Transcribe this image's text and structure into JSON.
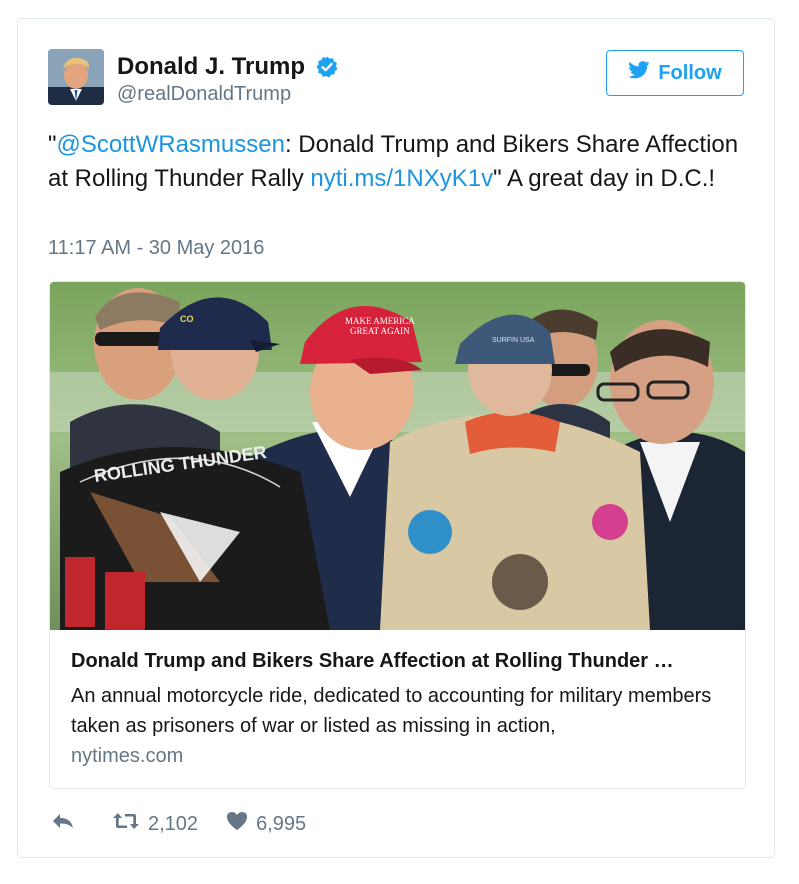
{
  "author": {
    "display_name": "Donald J. Trump",
    "handle": "@realDonaldTrump",
    "verified_icon": "verified-badge-icon"
  },
  "follow_button": {
    "label": "Follow",
    "icon": "twitter-bird-icon"
  },
  "tweet": {
    "quote_open": "\"",
    "mention": "@ScottWRasmussen",
    "text_part1": ": Donald Trump and Bikers Share Affection at Rolling Thunder Rally ",
    "link": "nyti.ms/1NXyK1v",
    "text_part2": "\" A great day in D.C.!",
    "timestamp": "11:17 AM - 30 May 2016"
  },
  "card": {
    "photo_text": {
      "vest_patch": "ROLLING THUNDER",
      "hat_text_line1": "MAKE AMERICA",
      "hat_text_line2": "GREAT AGAIN",
      "cap_text": "CO",
      "cap2_text": "SURFIN USA"
    },
    "title": "Donald Trump and Bikers Share Affection at Rolling Thunder …",
    "description": "An annual motorcycle ride, dedicated to accounting for military members taken as prisoners of war or listed as missing in action,",
    "domain": "nytimes.com"
  },
  "actions": {
    "reply_icon": "reply-icon",
    "retweet_icon": "retweet-icon",
    "retweet_count": "2,102",
    "like_icon": "heart-icon",
    "like_count": "6,995"
  },
  "colors": {
    "accent": "#1da1f2",
    "link": "#1b95e0",
    "muted": "#657786",
    "border": "#e1e8ed"
  }
}
